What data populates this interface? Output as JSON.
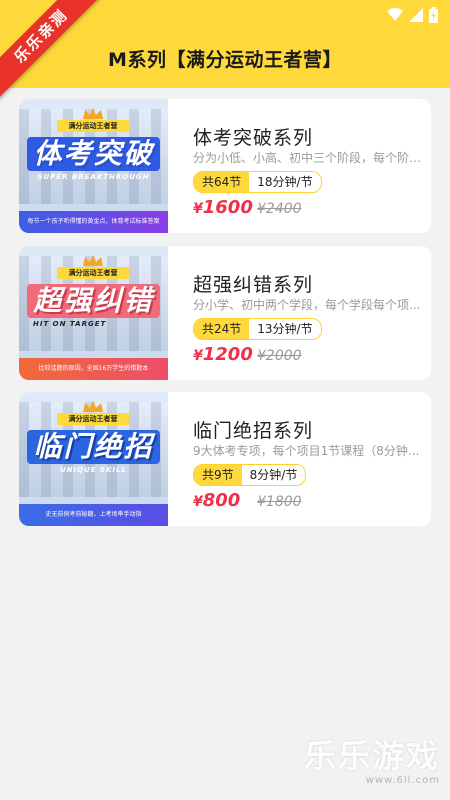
{
  "header": {
    "title": "M系列【满分运动王者营】",
    "ribbon": "乐乐亲测"
  },
  "courses": [
    {
      "thumb_tag": "满分运动王者营",
      "thumb_title": "体考突破",
      "thumb_sub": "SUPER BREAKTHROUGH",
      "thumb_band": "每节一个孩子听得懂的黄金点，体育考试标准答案",
      "title": "体考突破系列",
      "desc": "分为小低、小高、初中三个阶段，每个阶段...",
      "lessons": "共64节",
      "duration": "18分钟/节",
      "price_symbol": "¥",
      "price": "1600",
      "original_price": "¥2400"
    },
    {
      "thumb_tag": "满分运动王者营",
      "thumb_title": "超强纠错",
      "thumb_sub": "HIT ON TARGET",
      "thumb_band": "比较话题的原因，全国16万学生的错题本",
      "title": "超强纠错系列",
      "desc": "分小学、初中两个学段，每个学段每个项...",
      "lessons": "共24节",
      "duration": "13分钟/节",
      "price_symbol": "¥",
      "price": "1200",
      "original_price": "¥2000"
    },
    {
      "thumb_tag": "满分运动王者营",
      "thumb_title": "临门绝招",
      "thumb_sub": "UNIQUE SKILL",
      "thumb_band": "史无前例考前秘籍，上考场率手动指",
      "title": "临门绝招系列",
      "desc": "9大体考专项，每个项目1节课程（8分钟...",
      "lessons": "共9节",
      "duration": "8分钟/节",
      "price_symbol": "¥",
      "price": "800",
      "original_price": "¥1800"
    }
  ],
  "watermark": {
    "main": "乐乐游戏",
    "url": "www.6ll.com"
  },
  "icons": [
    "wifi-icon",
    "signal-icon",
    "battery-icon",
    "crown-icon"
  ],
  "colors": {
    "header": "#ffd93b",
    "price": "#f0304a",
    "ribbon": "#e8322a"
  }
}
